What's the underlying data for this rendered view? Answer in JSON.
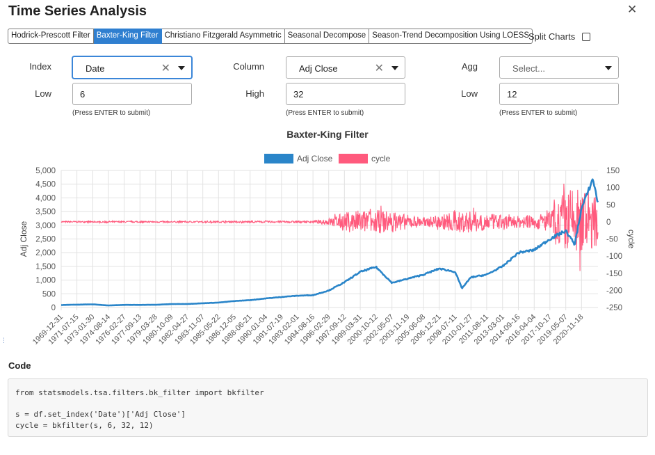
{
  "header": {
    "title": "Time Series Analysis",
    "close_icon": "close-icon"
  },
  "tabs": [
    {
      "label": "Hodrick-Prescott Filter",
      "active": false
    },
    {
      "label": "Baxter-King Filter",
      "active": true
    },
    {
      "label": "Christiano Fitzgerald Asymmetric",
      "active": false
    },
    {
      "label": "Seasonal Decompose",
      "active": false
    },
    {
      "label": "Season-Trend Decomposition Using LOESS",
      "active": false
    }
  ],
  "split_charts": {
    "label": "Split Charts",
    "checked": false
  },
  "controls": {
    "index": {
      "label": "Index",
      "value": "Date"
    },
    "column": {
      "label": "Column",
      "value": "Adj Close"
    },
    "agg": {
      "label": "Agg",
      "placeholder": "Select..."
    },
    "low": {
      "label": "Low",
      "value": "6",
      "hint": "(Press ENTER to submit)"
    },
    "high": {
      "label": "High",
      "value": "32",
      "hint": "(Press ENTER to submit)"
    },
    "k": {
      "label": "Low",
      "value": "12",
      "hint": "(Press ENTER to submit)"
    }
  },
  "chart_data": {
    "type": "line",
    "title": "Baxter-King Filter",
    "ylabel": "Adj Close",
    "y2label": "cycle",
    "ylim": [
      0,
      5000
    ],
    "y2lim": [
      -250,
      150
    ],
    "y_ticks": [
      "0",
      "500",
      "1,000",
      "1,500",
      "2,000",
      "2,500",
      "3,000",
      "3,500",
      "4,000",
      "4,500",
      "5,000"
    ],
    "y2_ticks": [
      "-250",
      "-200",
      "-150",
      "-100",
      "-50",
      "0",
      "50",
      "100",
      "150"
    ],
    "x_ticks": [
      "1969-12-31",
      "1971-07-15",
      "1973-01-30",
      "1974-08-14",
      "1976-02-27",
      "1977-09-13",
      "1979-03-28",
      "1980-10-09",
      "1982-04-27",
      "1983-11-07",
      "1985-05-22",
      "1986-12-05",
      "1988-06-21",
      "1990-01-04",
      "1991-07-19",
      "1993-02-01",
      "1994-08-16",
      "1996-02-29",
      "1997-09-12",
      "1999-03-31",
      "2000-10-12",
      "2002-05-07",
      "2003-11-19",
      "2005-06-08",
      "2006-12-21",
      "2008-07-11",
      "2010-01-27",
      "2011-08-11",
      "2013-03-01",
      "2014-09-16",
      "2016-04-04",
      "2017-10-17",
      "2019-05-07",
      "2020-11-18"
    ],
    "legend": "top-center",
    "grid": true,
    "series": [
      {
        "name": "Adj Close",
        "color": "#2a85c9",
        "x": [
          "1969-12-31",
          "1971-07-15",
          "1973-01-30",
          "1974-08-14",
          "1976-02-27",
          "1977-09-13",
          "1979-03-28",
          "1980-10-09",
          "1982-04-27",
          "1983-11-07",
          "1985-05-22",
          "1986-12-05",
          "1988-06-21",
          "1990-01-04",
          "1991-07-19",
          "1993-02-01",
          "1994-08-16",
          "1996-02-29",
          "1997-09-12",
          "1999-03-31",
          "2000-10-12",
          "2002-05-07",
          "2003-11-19",
          "2005-06-08",
          "2006-12-21",
          "2008-07-11",
          "2009-03-09",
          "2010-01-27",
          "2011-08-11",
          "2013-03-01",
          "2014-09-16",
          "2016-04-04",
          "2017-10-17",
          "2019-05-07",
          "2020-03-20",
          "2020-11-18",
          "2021-12-31",
          "2022-06-30"
        ],
        "values": [
          90,
          105,
          115,
          75,
          95,
          95,
          100,
          125,
          130,
          155,
          180,
          235,
          270,
          330,
          385,
          430,
          450,
          620,
          920,
          1300,
          1480,
          900,
          1050,
          1200,
          1420,
          1300,
          700,
          1100,
          1200,
          1500,
          2000,
          2100,
          2500,
          2800,
          2300,
          3600,
          4700,
          3800
        ]
      },
      {
        "name": "cycle",
        "color": "#ff5a7d",
        "x": [
          "1969-12-31",
          "1994-08-16",
          "1996-02-29",
          "1997-09-12",
          "1999-03-31",
          "2000-10-12",
          "2002-05-07",
          "2003-11-19",
          "2005-06-08",
          "2006-12-21",
          "2008-07-11",
          "2010-01-27",
          "2011-08-11",
          "2013-03-01",
          "2014-09-16",
          "2016-04-04",
          "2017-10-17",
          "2019-05-07",
          "2020-11-18",
          "2022-06-30"
        ],
        "envelope": [
          3,
          4,
          15,
          40,
          50,
          50,
          45,
          30,
          20,
          25,
          50,
          45,
          35,
          30,
          25,
          30,
          45,
          140,
          150,
          100
        ]
      }
    ]
  },
  "code": {
    "title": "Code",
    "lines": [
      "from statsmodels.tsa.filters.bk_filter import bkfilter",
      "",
      "s = df.set_index('Date')['Adj Close']",
      "cycle = bkfilter(s, 6, 32, 12)"
    ],
    "text": "from statsmodels.tsa.filters.bk_filter import bkfilter\n\ns = df.set_index('Date')['Adj Close']\ncycle = bkfilter(s, 6, 32, 12)"
  }
}
